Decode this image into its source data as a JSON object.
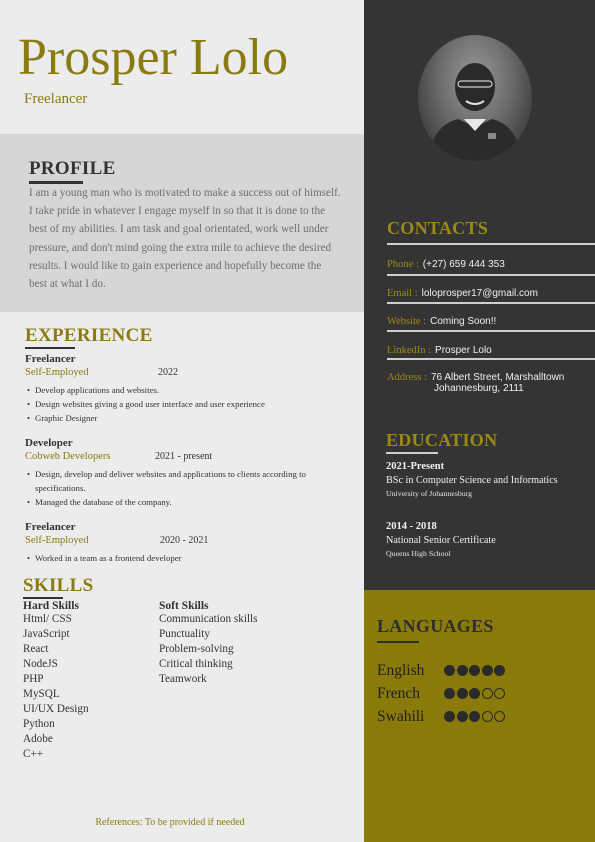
{
  "header": {
    "name": "Prosper Lolo",
    "role": "Freelancer"
  },
  "profile": {
    "title": "PROFILE",
    "text": "I am a young man who is motivated to make a success out of himself. I take pride in whatever I engage myself in so that it is done to the best of my abilities. I am task and goal orientated, work well under pressure, and don't mind going the extra mile to achieve the desired results. I would like to gain experience and hopefully become the best at what I do."
  },
  "experience": {
    "title": "EXPERIENCE",
    "jobs": [
      {
        "title": "Freelancer",
        "company": "Self-Employed",
        "date": "2022",
        "bullets": [
          "Develop applications and websites.",
          "Design websites giving a good user interface and user experience",
          "Graphic Designer"
        ]
      },
      {
        "title": "Developer",
        "company": "Cobweb Developers",
        "date": "2021 - present",
        "bullets": [
          "Design, develop and deliver websites and applications to clients according to specifications.",
          "Managed the database of the company."
        ]
      },
      {
        "title": "Freelancer",
        "company": "Self-Employed",
        "date": "2020 - 2021",
        "bullets": [
          "Worked in a team as a frontend developer"
        ]
      }
    ]
  },
  "skills": {
    "title": "SKILLS",
    "hard_title": "Hard Skills",
    "hard": [
      "Html/ CSS",
      "JavaScript",
      "React",
      "NodeJS",
      "PHP",
      "MySQL",
      "UI/UX Design",
      "Python",
      "Adobe",
      "C++"
    ],
    "soft_title": "Soft Skills",
    "soft": [
      "Communication skills",
      "Punctuality",
      "Problem-solving",
      "Critical thinking",
      "Teamwork"
    ]
  },
  "references": "References: To be provided if needed",
  "contacts": {
    "title": "CONTACTS",
    "phone_label": "Phone :",
    "phone": "(+27) 659 444 353",
    "email_label": "Email :",
    "email": "loloprosper17@gmail.com",
    "website_label": "Website :",
    "website": "Coming Soon!!",
    "linkedin_label": "LinkedIn :",
    "linkedin": "Prosper Lolo",
    "address_label": "Address :",
    "address_line1": "76 Albert Street, Marshalltown",
    "address_line2": "Johannesburg, 2111"
  },
  "education": {
    "title": "EDUCATION",
    "items": [
      {
        "date": "2021-Present",
        "degree": "BSc in Computer Science and Informatics",
        "school": "University of Johannesburg"
      },
      {
        "date": "2014 - 2018",
        "degree": "National Senior Certificate",
        "school": "Queens High School"
      }
    ]
  },
  "languages": {
    "title": "LANGUAGES",
    "items": [
      {
        "name": "English",
        "level": 5,
        "max": 5
      },
      {
        "name": "French",
        "level": 3,
        "max": 5
      },
      {
        "name": "Swahili",
        "level": 3,
        "max": 5
      }
    ]
  },
  "colors": {
    "accent": "#8a7a10",
    "dark_panel": "#343434",
    "gold_panel": "#8a7a0a",
    "profile_band": "#d6d6d6",
    "page": "#ececec"
  }
}
